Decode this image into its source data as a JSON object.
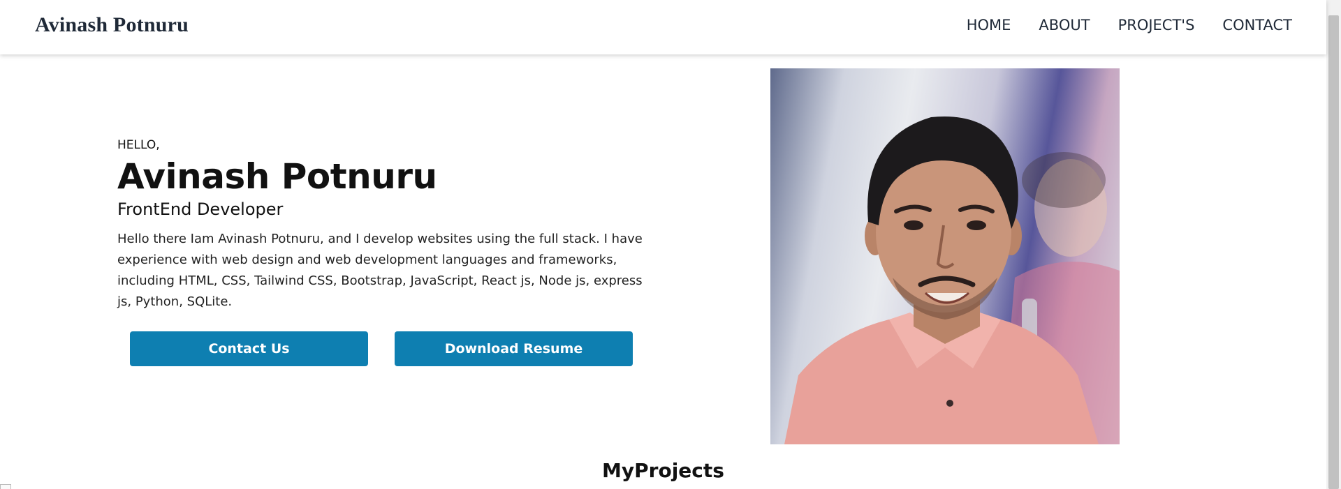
{
  "navbar": {
    "brand": "Avinash Potnuru",
    "links": [
      "HOME",
      "ABOUT",
      "PROJECT'S",
      "CONTACT"
    ]
  },
  "hero": {
    "greeting": "HELLO,",
    "name": "Avinash Potnuru",
    "role": "FrontEnd Developer",
    "description": "Hello there Iam Avinash Potnuru, and I develop websites using the full stack. I have experience with web design and web development languages and frameworks, including HTML, CSS, Tailwind CSS, Bootstrap, JavaScript, React js, Node js, express js, Python, SQLite.",
    "buttons": {
      "contact": "Contact Us",
      "resume": "Download Resume"
    },
    "photo_icon": "profile-photo"
  },
  "projects": {
    "title": "MyProjects"
  },
  "colors": {
    "accent": "#0e7fb1",
    "nav_text": "#1f2937"
  }
}
